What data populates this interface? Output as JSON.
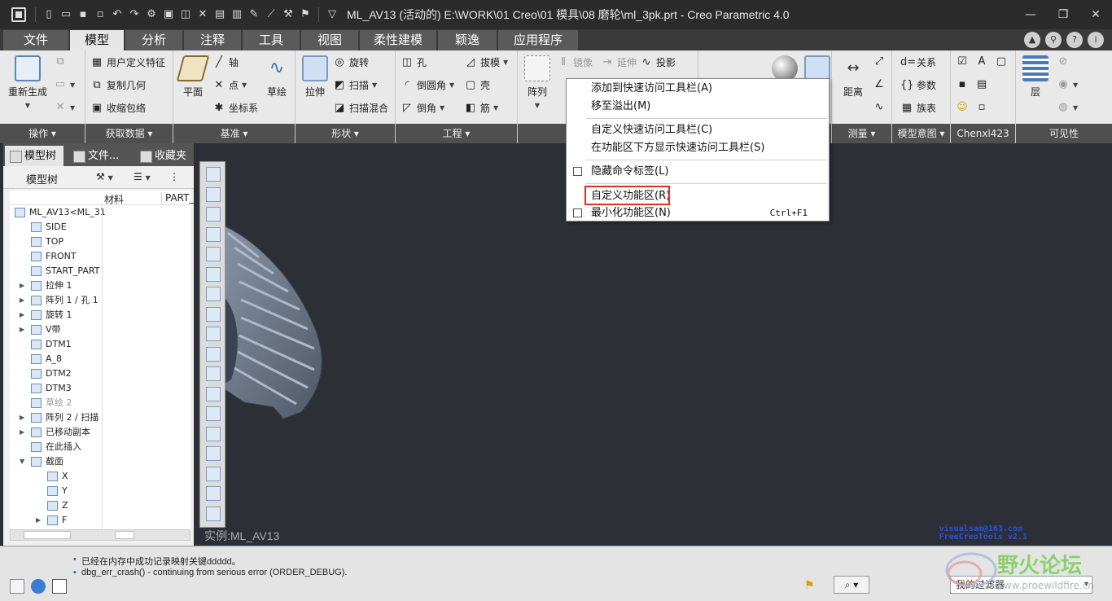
{
  "titlebar": {
    "title": "ML_AV13 (活动的) E:\\WORK\\01 Creo\\01 模具\\08 磨轮\\ml_3pk.prt - Creo Parametric 4.0"
  },
  "tabs": [
    "文件",
    "模型",
    "分析",
    "注释",
    "工具",
    "视图",
    "柔性建模",
    "颖逸",
    "应用程序"
  ],
  "active_tab": "模型",
  "ribbon": {
    "ops": {
      "regen": "重新生成",
      "footer": "操作"
    },
    "getdata": {
      "udf": "用户定义特征",
      "copygeom": "复制几何",
      "shrinkwrap": "收缩包络",
      "footer": "获取数据"
    },
    "datum": {
      "plane": "平面",
      "axis": "轴",
      "point": "点",
      "csys": "坐标系",
      "sketch": "草绘",
      "footer": "基准"
    },
    "shapes": {
      "extrude": "拉伸",
      "revolve": "旋转",
      "sweep": "扫描",
      "sweepblend": "扫描混合",
      "footer": "形状"
    },
    "engineering": {
      "hole": "孔",
      "round": "倒圆角",
      "chamfer": "倒角",
      "draft": "拔模",
      "shell": "壳",
      "rib": "筋",
      "footer": "工程"
    },
    "editing": {
      "pattern": "阵列",
      "mirror": "镜像",
      "extend": "延伸",
      "project": "投影"
    },
    "measure": {
      "distance": "距离",
      "footer": "测量"
    },
    "intent": {
      "relations": "关系",
      "params": "参数",
      "family": "族表",
      "footer": "模型意图"
    },
    "custom": {
      "footer": "Chenxl423"
    },
    "visibility": {
      "layers": "层",
      "footer": "可见性"
    }
  },
  "context_menu": {
    "items": [
      {
        "label": "添加到快速访问工具栏(A)",
        "checkbox": false
      },
      {
        "label": "移至溢出(M)",
        "checkbox": false
      },
      {
        "label": "自定义快速访问工具栏(C)",
        "checkbox": false
      },
      {
        "label": "在功能区下方显示快速访问工具栏(S)",
        "checkbox": false
      },
      {
        "label": "隐藏命令标签(L)",
        "checkbox": true
      },
      {
        "label": "自定义功能区(R)",
        "checkbox": false
      },
      {
        "label": "最小化功能区(N)",
        "checkbox": true,
        "shortcut": "Ctrl+F1"
      }
    ]
  },
  "panel": {
    "tabs": [
      "模型树",
      "文件...",
      "收藏夹"
    ],
    "title": "模型树",
    "columns": [
      "材料",
      "PART_"
    ],
    "tree": [
      {
        "label": "ML_AV13<ML_31",
        "indent": 0,
        "expander": ""
      },
      {
        "label": "SIDE",
        "indent": 1,
        "expander": ""
      },
      {
        "label": "TOP",
        "indent": 1,
        "expander": ""
      },
      {
        "label": "FRONT",
        "indent": 1,
        "expander": ""
      },
      {
        "label": "START_PART",
        "indent": 1,
        "expander": ""
      },
      {
        "label": "拉伸 1",
        "indent": 1,
        "expander": "▶"
      },
      {
        "label": "阵列 1 / 孔 1",
        "indent": 1,
        "expander": "▶"
      },
      {
        "label": "旋转 1",
        "indent": 1,
        "expander": "▶"
      },
      {
        "label": "V带",
        "indent": 1,
        "expander": "▶"
      },
      {
        "label": "DTM1",
        "indent": 1,
        "expander": ""
      },
      {
        "label": "A_8",
        "indent": 1,
        "expander": ""
      },
      {
        "label": "DTM2",
        "indent": 1,
        "expander": ""
      },
      {
        "label": "DTM3",
        "indent": 1,
        "expander": ""
      },
      {
        "label": "草绘 2",
        "indent": 1,
        "expander": "",
        "grey": true
      },
      {
        "label": "阵列 2 / 扫描",
        "indent": 1,
        "expander": "▶"
      },
      {
        "label": "已移动副本",
        "indent": 1,
        "expander": "▶"
      },
      {
        "label": "在此插入",
        "indent": 1,
        "expander": ""
      },
      {
        "label": "截面",
        "indent": 1,
        "expander": "▼"
      },
      {
        "label": "X",
        "indent": 2,
        "expander": ""
      },
      {
        "label": "Y",
        "indent": 2,
        "expander": ""
      },
      {
        "label": "Z",
        "indent": 2,
        "expander": ""
      },
      {
        "label": "F",
        "indent": 2,
        "expander": "▶"
      }
    ]
  },
  "viewport": {
    "instance": "实例:ML_AV13",
    "credit_line1": "visualsam@163.com",
    "credit_line2": "FreeCreoTools v2.1"
  },
  "statusbar": {
    "messages": [
      "已经在内存中成功记录映射关键ddddd。",
      "dbg_err_crash() - continuing from serious error (ORDER_DEBUG)."
    ],
    "filter": "我的过滤器"
  },
  "watermark": {
    "title": "野火论坛",
    "url": "www.proewildfire.cn"
  },
  "colors": {
    "accent": "#d9302a",
    "titlebar": "#2b2b2b",
    "viewport": "#2c2f36",
    "model": "#6f7b8f"
  }
}
